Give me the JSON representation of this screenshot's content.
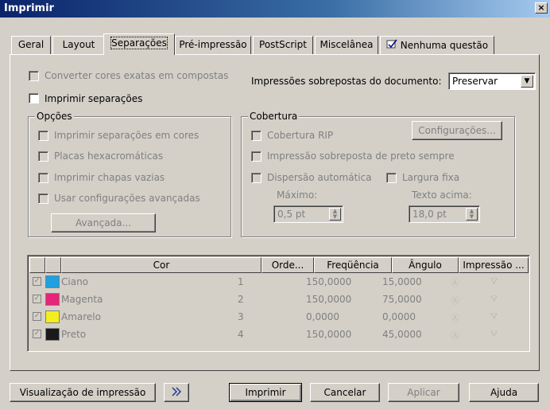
{
  "window": {
    "title": "Imprimir",
    "close": "×"
  },
  "tabs": [
    "Geral",
    "Layout",
    "Separações",
    "Pré-impressão",
    "PostScript",
    "Miscelânea",
    "Nenhuma questão"
  ],
  "top": {
    "convert_label": "Converter cores exatas em compostas",
    "overprint_label": "Impressões sobrepostas do documento:",
    "overprint_value": "Preservar",
    "print_sep_label": "Imprimir separações"
  },
  "options": {
    "title": "Opções",
    "items": [
      "Imprimir separações em cores",
      "Placas hexacromáticas",
      "Imprimir chapas vazias",
      "Usar configurações avançadas"
    ],
    "advanced_button": "Avançada..."
  },
  "coverage": {
    "title": "Cobertura",
    "rip_label": "Cobertura RIP",
    "config_button": "Configurações...",
    "overprint_black": "Impressão sobreposta de preto sempre",
    "auto_spread": "Dispersão automática",
    "fixed_width": "Largura fixa",
    "max_label": "Máximo:",
    "max_value": "0,5 pt",
    "text_above_label": "Texto acima:",
    "text_above_value": "18,0 pt"
  },
  "table": {
    "headers": [
      "Cor",
      "Orde...",
      "Freqüência",
      "Ângulo",
      "Impressão ..."
    ],
    "rows": [
      {
        "name": "Ciano",
        "order": "1",
        "freq": "150,0000",
        "angle": "15,0000",
        "color": "#1fa0e0"
      },
      {
        "name": "Magenta",
        "order": "2",
        "freq": "150,0000",
        "angle": "75,0000",
        "color": "#e8237a"
      },
      {
        "name": "Amarelo",
        "order": "3",
        "freq": "0,0000",
        "angle": "0,0000",
        "color": "#f5ee1e"
      },
      {
        "name": "Preto",
        "order": "4",
        "freq": "150,0000",
        "angle": "45,0000",
        "color": "#1a1a1a"
      }
    ]
  },
  "footer": {
    "preview_button": "Visualização de impressão",
    "print_button": "Imprimir",
    "cancel_button": "Cancelar",
    "apply_button": "Aplicar",
    "help_button": "Ajuda"
  }
}
